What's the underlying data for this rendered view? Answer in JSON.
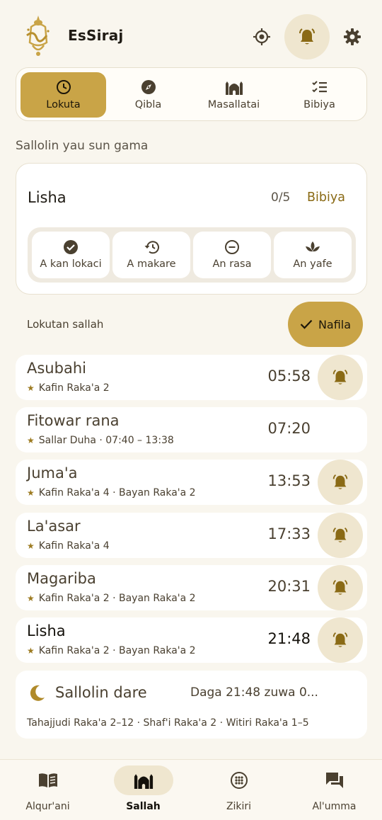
{
  "header": {
    "app_name": "EsSiraj",
    "icons": [
      "logo",
      "location-icon",
      "bell-icon",
      "gear-icon"
    ],
    "accent_color": "#c9a447"
  },
  "tabs": [
    {
      "label": "Lokuta",
      "icon": "clock-icon",
      "active": true
    },
    {
      "label": "Qibla",
      "icon": "compass-icon",
      "active": false
    },
    {
      "label": "Masallatai",
      "icon": "mosque-icon",
      "active": false
    },
    {
      "label": "Bibiya",
      "icon": "checklist-icon",
      "active": false
    }
  ],
  "status": {
    "section_label": "Sallolin yau sun gama",
    "prayer": "Lisha",
    "count": "0/5",
    "all_label": "Bibiya",
    "choices": [
      {
        "label": "A kan lokaci",
        "icon": "check-circle-icon"
      },
      {
        "label": "A makare",
        "icon": "history-icon"
      },
      {
        "label": "An rasa",
        "icon": "minus-circle-icon"
      },
      {
        "label": "An yafe",
        "icon": "lotus-icon"
      }
    ]
  },
  "times": {
    "label": "Lokutan sallah",
    "nafila_label": "Nafila"
  },
  "prayers": [
    {
      "name": "Asubahi",
      "detail": "Kafin Raka'a 2",
      "time": "05:58",
      "bell": true
    },
    {
      "name": "Fitowar rana",
      "detail": "Sallar Duha · 07:40 – 13:38",
      "time": "07:20",
      "bell": false
    },
    {
      "name": "Juma'a",
      "detail": "Kafin Raka'a 4 · Bayan Raka'a 2",
      "time": "13:53",
      "bell": true
    },
    {
      "name": "La'asar",
      "detail": "Kafin Raka'a 4",
      "time": "17:33",
      "bell": true
    },
    {
      "name": "Magariba",
      "detail": "Kafin Raka'a 2 · Bayan Raka'a 2",
      "time": "20:31",
      "bell": true
    },
    {
      "name": "Lisha",
      "detail": "Kafin Raka'a 2 · Bayan Raka'a 2",
      "time": "21:48",
      "bell": true
    }
  ],
  "night": {
    "title": "Sallolin dare",
    "until": "Daga 21:48 zuwa 0...",
    "detail": "Tahajjudi Raka'a 2–12 · Shaf'i Raka'a 2 · Witiri Raka'a 1–5"
  },
  "nav": [
    {
      "label": "Alqur'ani",
      "icon": "book-icon",
      "active": false
    },
    {
      "label": "Sallah",
      "icon": "mosque-icon",
      "active": true
    },
    {
      "label": "Zikiri",
      "icon": "beads-icon",
      "active": false
    },
    {
      "label": "Al'umma",
      "icon": "chat-icon",
      "active": false
    }
  ]
}
